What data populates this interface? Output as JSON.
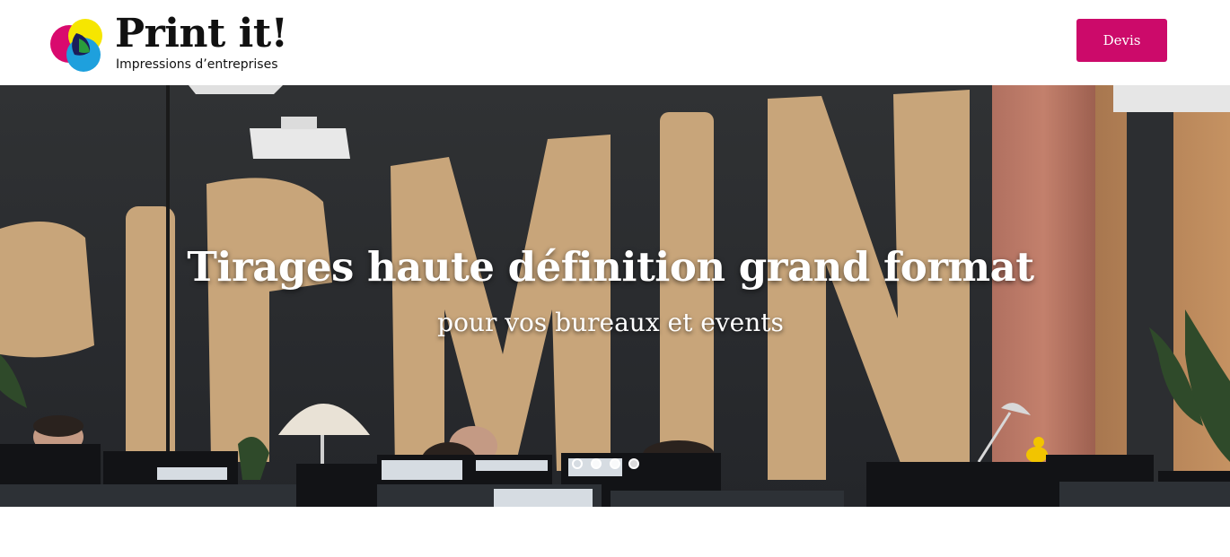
{
  "header": {
    "logo_title": "Print it!",
    "logo_subtitle": "Impressions d’entreprises",
    "devis_label": "Devis"
  },
  "hero": {
    "title": "Tirages haute définition grand format",
    "subtitle": "pour vos bureaux et events",
    "slides": [
      {
        "active": true
      },
      {
        "active": false
      },
      {
        "active": false
      },
      {
        "active": false
      }
    ]
  },
  "colors": {
    "accent": "#cc0a6a",
    "logo_magenta": "#d90a6e",
    "logo_yellow": "#f6e600",
    "logo_cyan": "#1ea0dd"
  }
}
